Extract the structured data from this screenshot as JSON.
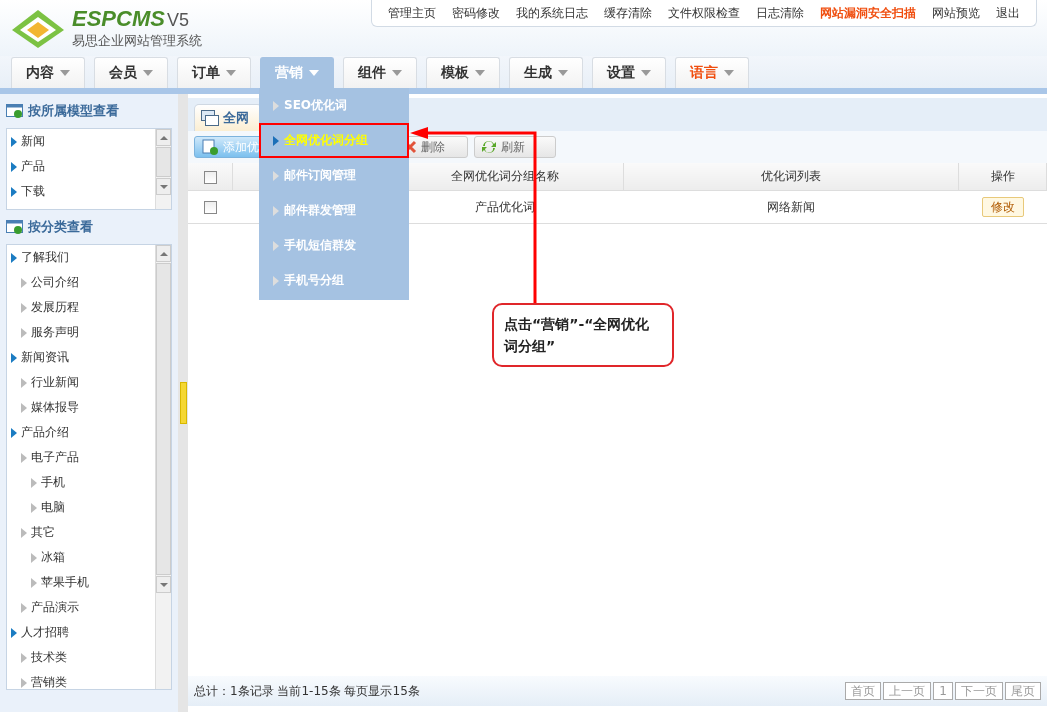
{
  "logo": {
    "brand": "ESPCMS",
    "version": "V5",
    "subtitle": "易思企业网站管理系统"
  },
  "top_links": [
    {
      "label": "管理主页",
      "alert": false
    },
    {
      "label": "密码修改",
      "alert": false
    },
    {
      "label": "我的系统日志",
      "alert": false
    },
    {
      "label": "缓存清除",
      "alert": false
    },
    {
      "label": "文件权限检查",
      "alert": false
    },
    {
      "label": "日志清除",
      "alert": false
    },
    {
      "label": "网站漏洞安全扫描",
      "alert": true
    },
    {
      "label": "网站预览",
      "alert": false
    },
    {
      "label": "退出",
      "alert": false
    }
  ],
  "nav_tabs": [
    {
      "label": "内容",
      "selected": false,
      "alert": false
    },
    {
      "label": "会员",
      "selected": false,
      "alert": false
    },
    {
      "label": "订单",
      "selected": false,
      "alert": false
    },
    {
      "label": "营销",
      "selected": true,
      "alert": false
    },
    {
      "label": "组件",
      "selected": false,
      "alert": false
    },
    {
      "label": "模板",
      "selected": false,
      "alert": false
    },
    {
      "label": "生成",
      "selected": false,
      "alert": false
    },
    {
      "label": "设置",
      "selected": false,
      "alert": false
    },
    {
      "label": "语言",
      "selected": false,
      "alert": true
    }
  ],
  "dropdown_menu": [
    {
      "label": "SEO优化词",
      "selected": false
    },
    {
      "label": "全网优化词分组",
      "selected": true
    },
    {
      "label": "邮件订阅管理",
      "selected": false
    },
    {
      "label": "邮件群发管理",
      "selected": false
    },
    {
      "label": "手机短信群发",
      "selected": false
    },
    {
      "label": "手机号分组",
      "selected": false
    }
  ],
  "sidebar": {
    "model_panel": {
      "title": "按所属模型查看",
      "items": [
        {
          "label": "新闻"
        },
        {
          "label": "产品"
        },
        {
          "label": "下载"
        }
      ]
    },
    "category_panel": {
      "title": "按分类查看",
      "items": [
        {
          "label": "了解我们",
          "children": [
            {
              "label": "公司介绍"
            },
            {
              "label": "发展历程"
            },
            {
              "label": "服务声明"
            }
          ]
        },
        {
          "label": "新闻资讯",
          "children": [
            {
              "label": "行业新闻"
            },
            {
              "label": "媒体报导"
            }
          ]
        },
        {
          "label": "产品介绍",
          "children": [
            {
              "label": "电子产品",
              "children": [
                {
                  "label": "手机"
                },
                {
                  "label": "电脑"
                }
              ]
            },
            {
              "label": "其它",
              "children": [
                {
                  "label": "冰箱"
                },
                {
                  "label": "苹果手机"
                }
              ]
            },
            {
              "label": "产品演示"
            }
          ]
        },
        {
          "label": "人才招聘",
          "children": [
            {
              "label": "技术类"
            },
            {
              "label": "营销类"
            }
          ]
        }
      ]
    }
  },
  "content": {
    "tab": "全网",
    "toolbar": [
      {
        "label": "添加优",
        "kind": "add"
      },
      {
        "label": "删除",
        "kind": "delete"
      },
      {
        "label": "刷新",
        "kind": "refresh"
      }
    ],
    "table": {
      "select_all_checked": false,
      "columns": [
        "全网优化词分组名称",
        "优化词列表",
        "操作"
      ],
      "rows": [
        {
          "checked": false,
          "name": "产品优化词",
          "words": "网络新闻",
          "action": "修改"
        }
      ]
    },
    "footer": {
      "summary": "总计：1条记录 当前1-15条 每页显示15条",
      "pagination": [
        "首页",
        "上一页",
        "1",
        "下一页",
        "尾页"
      ]
    }
  },
  "callout": {
    "text": "点击“营销”-“全网优化词分组”"
  }
}
